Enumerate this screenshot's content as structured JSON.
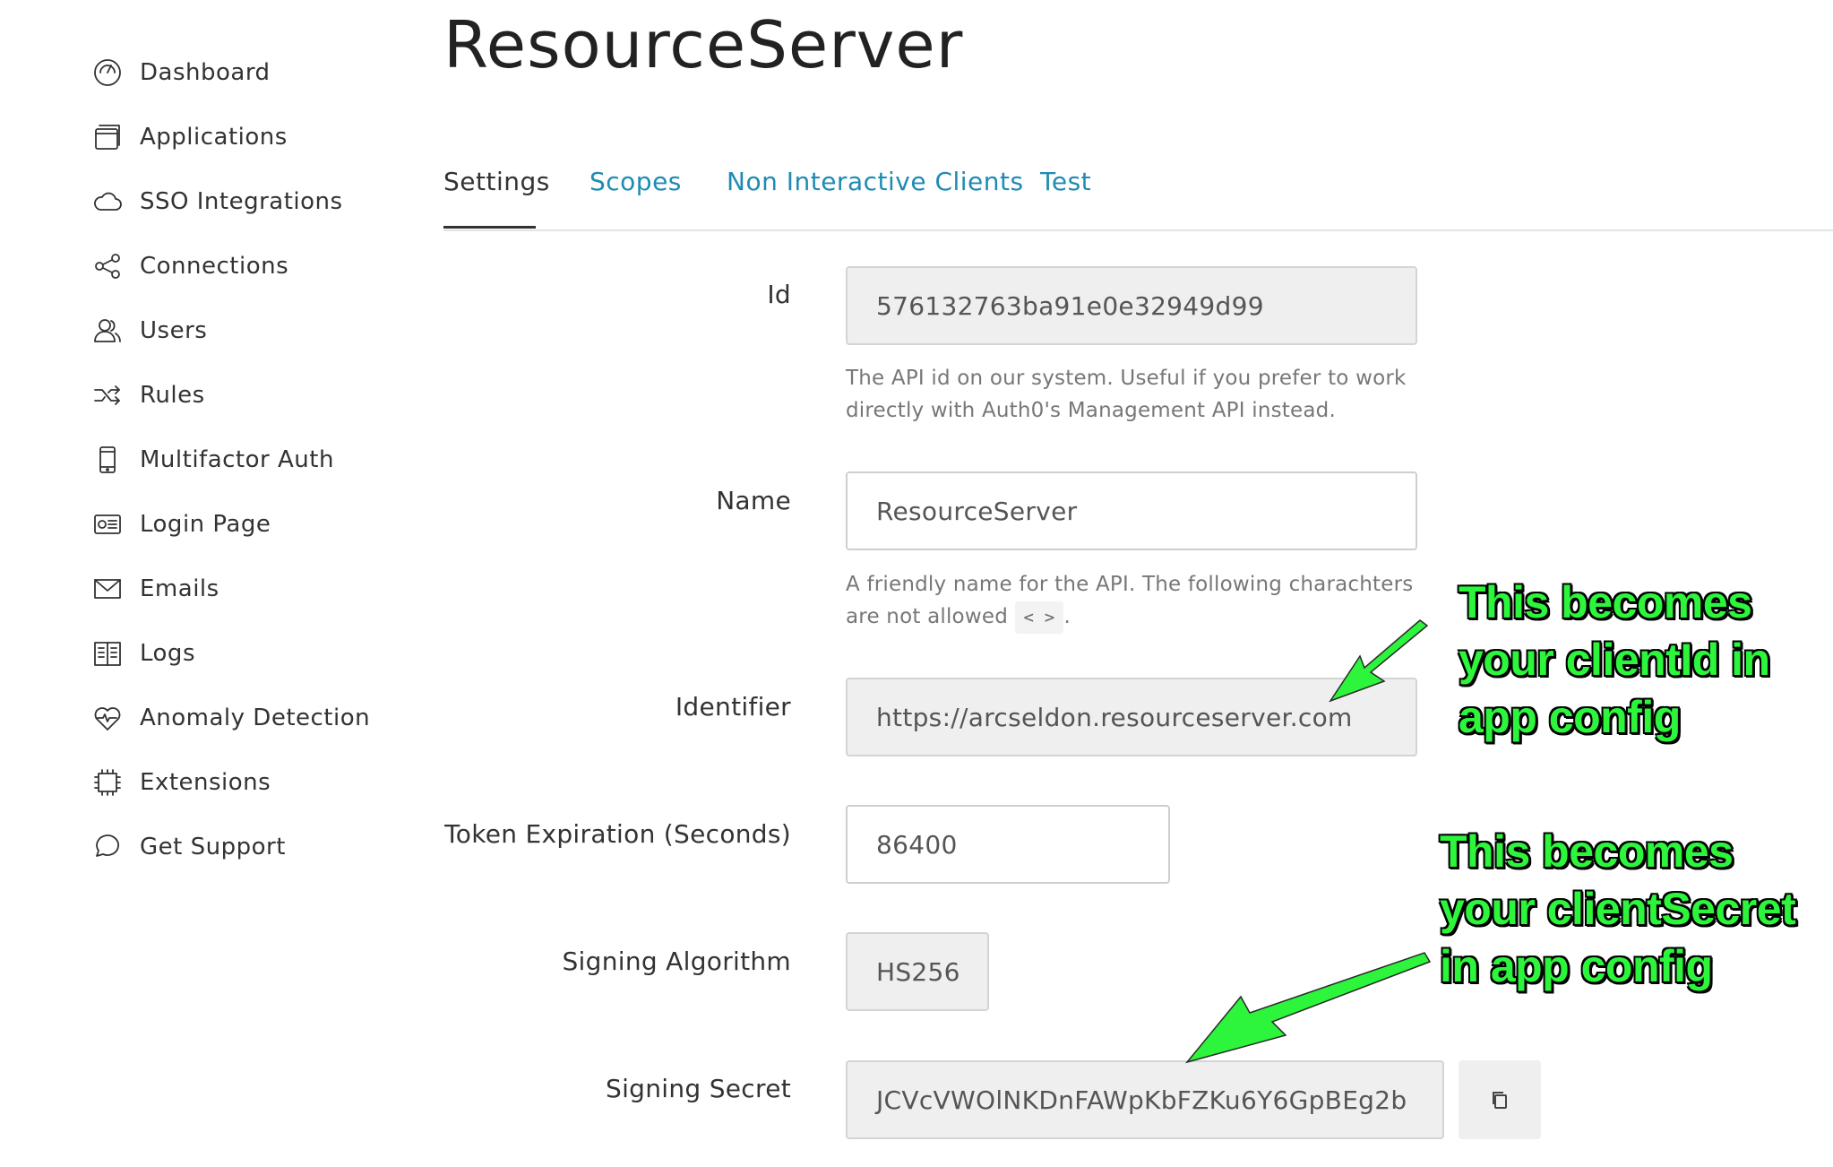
{
  "sidebar": {
    "items": [
      {
        "label": "Dashboard",
        "icon": "dashboard-icon"
      },
      {
        "label": "Applications",
        "icon": "applications-icon"
      },
      {
        "label": "SSO Integrations",
        "icon": "cloud-icon"
      },
      {
        "label": "Connections",
        "icon": "connections-icon"
      },
      {
        "label": "Users",
        "icon": "users-icon"
      },
      {
        "label": "Rules",
        "icon": "shuffle-icon"
      },
      {
        "label": "Multifactor Auth",
        "icon": "phone-icon"
      },
      {
        "label": "Login Page",
        "icon": "id-card-icon"
      },
      {
        "label": "Emails",
        "icon": "mail-icon"
      },
      {
        "label": "Logs",
        "icon": "book-icon"
      },
      {
        "label": "Anomaly Detection",
        "icon": "heart-pulse-icon"
      },
      {
        "label": "Extensions",
        "icon": "chip-icon"
      },
      {
        "label": "Get Support",
        "icon": "chat-bubble-icon"
      }
    ]
  },
  "page": {
    "title": "ResourceServer"
  },
  "tabs": [
    {
      "label": "Settings",
      "active": true
    },
    {
      "label": "Scopes",
      "active": false
    },
    {
      "label": "Non Interactive Clients",
      "active": false
    },
    {
      "label": "Test",
      "active": false
    }
  ],
  "form": {
    "id": {
      "label": "Id",
      "value": "576132763ba91e0e32949d99",
      "help": "The API id on our system. Useful if you prefer to work directly with Auth0's Management API instead."
    },
    "name": {
      "label": "Name",
      "value": "ResourceServer",
      "help_prefix": "A friendly name for the API. The following charachters are not allowed",
      "help_chip": "< >",
      "help_suffix": "."
    },
    "identifier": {
      "label": "Identifier",
      "value": "https://arcseldon.resourceserver.com"
    },
    "token_expiration": {
      "label": "Token Expiration (Seconds)",
      "value": "86400"
    },
    "signing_algorithm": {
      "label": "Signing Algorithm",
      "value": "HS256"
    },
    "signing_secret": {
      "label": "Signing Secret",
      "value": "JCVcVWOlNKDnFAWpKbFZKu6Y6GpBEg2b",
      "copy_icon": "copy-icon"
    }
  },
  "annotations": {
    "client_id": [
      "This becomes",
      "your clientId in",
      "app config"
    ],
    "client_secret": [
      "This becomes",
      "your clientSecret",
      "in app config"
    ],
    "color": "#2cf53c"
  },
  "colors": {
    "link": "#1f8bb4",
    "text": "#333333",
    "readonly_bg": "#efefef"
  }
}
